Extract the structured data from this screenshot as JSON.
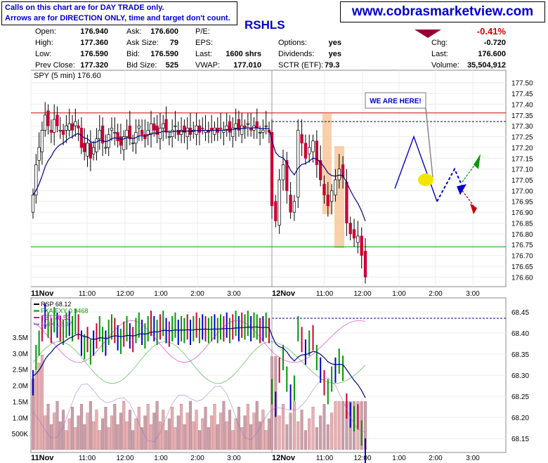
{
  "notice": {
    "line1": "Calls on this chart are for DAY TRADE only.",
    "line2": "Arrows are for DIRECTION ONLY, time and target don't count."
  },
  "site": "www.cobrasmarketview.com",
  "symbol": "RSHLS",
  "quote": {
    "open_label": "Open:",
    "open": "176.940",
    "high_label": "High:",
    "high": "177.360",
    "low_label": "Low:",
    "low": "176.590",
    "prev_label": "Prev Close:",
    "prev": "177.320",
    "ask_label": "Ask:",
    "ask": "176.600",
    "asksize_label": "Ask Size:",
    "asksize": "79",
    "bid_label": "Bid:",
    "bid": "176.590",
    "bidsize_label": "Bid Size:",
    "bidsize": "525",
    "pe_label": "P/E:",
    "eps_label": "EPS:",
    "last_label": "Last:",
    "last": "1600 shrs",
    "vwap_label": "VWAP:",
    "vwap": "177.010",
    "options_label": "Options:",
    "options": "yes",
    "dividends_label": "Dividends:",
    "dividends": "yes",
    "sctr_label": "SCTR (ETF):",
    "sctr": "79.3",
    "chg_pct": "-0.41%",
    "chg_label": "Chg:",
    "chg": "-0.720",
    "last2_label": "Last:",
    "last2": "176.600",
    "volume_label": "Volume:",
    "volume": "35,504,912"
  },
  "annotation": "WE ARE HERE!",
  "colors": {
    "up": "#009900",
    "down": "#cc0033",
    "blue": "#0000cc",
    "ma": "#000088",
    "red_line": "#cc0000",
    "green_line": "#009900",
    "highlight": "#f8c89a"
  },
  "chart_data": [
    {
      "type": "candlestick",
      "title": "SPY (5 min) 176.60",
      "ylim": [
        176.55,
        177.55
      ],
      "y_ticks": [
        "177.50",
        "177.45",
        "177.40",
        "177.35",
        "177.30",
        "177.25",
        "177.20",
        "177.15",
        "177.10",
        "177.05",
        "177.00",
        "176.95",
        "176.90",
        "176.85",
        "176.80",
        "176.75",
        "176.70",
        "176.65",
        "176.60"
      ],
      "x_ticks": [
        "11Nov",
        "11:00",
        "12:00",
        "1:00",
        "2:00",
        "3:00",
        "12Nov",
        "11:00",
        "12:00",
        "1:00",
        "2:00",
        "3:00"
      ],
      "horizontal_lines": {
        "red": 177.36,
        "green": 176.74,
        "dashed": 177.32
      },
      "projection_path": [
        177.01,
        177.25,
        176.95,
        177.1,
        176.95,
        177.04
      ],
      "closes": [
        176.98,
        177.12,
        177.2,
        177.28,
        177.35,
        177.3,
        177.27,
        177.33,
        177.3,
        177.28,
        177.26,
        177.3,
        177.31,
        177.28,
        177.32,
        177.29,
        177.2,
        177.18,
        177.22,
        177.15,
        177.2,
        177.24,
        177.28,
        177.22,
        177.2,
        177.26,
        177.29,
        177.27,
        177.23,
        177.21,
        177.25,
        177.28,
        177.24,
        177.22,
        177.27,
        177.3,
        177.26,
        177.24,
        177.28,
        177.31,
        177.28,
        177.26,
        177.29,
        177.31,
        177.27,
        177.25,
        177.28,
        177.3,
        177.26,
        177.28,
        177.27,
        177.29,
        177.26,
        177.28,
        177.3,
        177.27,
        177.29,
        177.28,
        177.27,
        177.28,
        177.29,
        177.27,
        177.29,
        177.28,
        177.3,
        177.27,
        177.29,
        177.31,
        177.28,
        177.3,
        177.29,
        177.31,
        177.28,
        177.3,
        177.29,
        177.27,
        177.28,
        177.3,
        177.27,
        176.93,
        176.86,
        177.05,
        177.12,
        177.0,
        176.9,
        176.95,
        177.28,
        177.22,
        177.15,
        177.2,
        177.23,
        177.12,
        177.05,
        176.98,
        176.93,
        177.0,
        177.05,
        177.1,
        177.06,
        176.85,
        176.8,
        176.78,
        176.79,
        176.7,
        176.6
      ]
    },
    {
      "type": "bar",
      "title": "RSP 68.12",
      "overlays": [
        "FXA:FXY 0.9468",
        "TBT 78.53",
        "$VIX 12.87"
      ],
      "overlay_colors": [
        "#009900",
        "#cc00aa",
        "#9966cc"
      ],
      "ylim": [
        68.12,
        68.48
      ],
      "y_ticks": [
        "68.45",
        "68.40",
        "68.35",
        "68.30",
        "68.25",
        "68.20",
        "68.15"
      ],
      "volume_ticks": [
        "3.5M",
        "3.0M",
        "2.5M",
        "2.0M",
        "1.5M",
        "1.0M",
        "500K"
      ],
      "x_ticks": [
        "11Nov",
        "11:00",
        "12:00",
        "1:00",
        "2:00",
        "3:00",
        "12Nov",
        "11:00",
        "12:00",
        "1:00",
        "2:00",
        "3:00"
      ],
      "dashed_line": 68.435
    }
  ]
}
